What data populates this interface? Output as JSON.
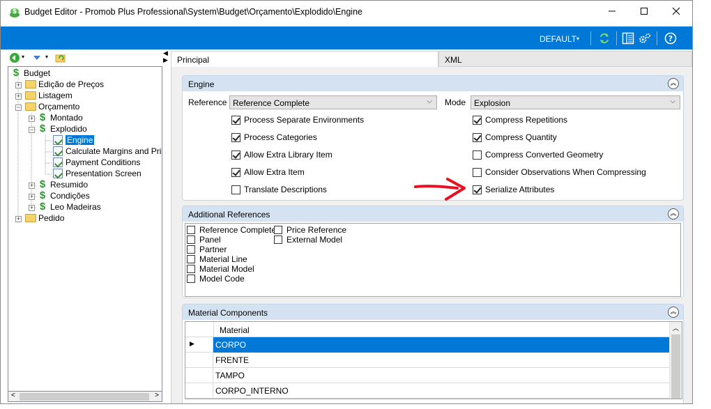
{
  "window": {
    "title": "Budget Editor - Promob Plus Professional\\System\\Budget\\Orçamento\\Explodido\\Engine",
    "minimize": "—",
    "maximize": "☐",
    "close": "✕"
  },
  "toolbar": {
    "default_label": "DEFAULT",
    "caret": "▾",
    "icons": [
      "refresh-icon",
      "panel-icon",
      "settings-icon",
      "help-icon"
    ]
  },
  "tree": {
    "nodes": [
      {
        "label": "Budget"
      },
      {
        "label": "Edição de Preços"
      },
      {
        "label": "Listagem"
      },
      {
        "label": "Orçamento"
      },
      {
        "label": "Montado"
      },
      {
        "label": "Explodido"
      },
      {
        "label": "Engine"
      },
      {
        "label": "Calculate Margins and Price"
      },
      {
        "label": "Payment Conditions"
      },
      {
        "label": "Presentation Screen"
      },
      {
        "label": "Resumido"
      },
      {
        "label": "Condições"
      },
      {
        "label": "Leo Madeiras"
      },
      {
        "label": "Pedido"
      }
    ]
  },
  "tabs": [
    {
      "label": "Principal",
      "active": true
    },
    {
      "label": "XML",
      "active": false
    }
  ],
  "engine": {
    "header": "Engine",
    "reference_label": "Reference",
    "reference_value": "Reference Complete",
    "mode_label": "Mode",
    "mode_value": "Explosion",
    "left_options": [
      {
        "label": "Process Separate Environments",
        "checked": true
      },
      {
        "label": "Process Categories",
        "checked": true
      },
      {
        "label": "Allow Extra Library Item",
        "checked": true
      },
      {
        "label": "Allow Extra Item",
        "checked": true
      },
      {
        "label": "Translate Descriptions",
        "checked": false
      }
    ],
    "right_options": [
      {
        "label": "Compress Repetitions",
        "checked": true
      },
      {
        "label": "Compress Quantity",
        "checked": true
      },
      {
        "label": "Compress Converted Geometry",
        "checked": false
      },
      {
        "label": "Consider Observations When Compressing",
        "checked": false
      },
      {
        "label": "Serialize Attributes",
        "checked": true
      }
    ]
  },
  "additional_references": {
    "header": "Additional References",
    "col1": [
      {
        "label": "Reference Complete",
        "checked": false
      },
      {
        "label": "Panel",
        "checked": false
      },
      {
        "label": "Partner",
        "checked": false
      },
      {
        "label": "Material Line",
        "checked": false
      },
      {
        "label": "Material Model",
        "checked": false
      },
      {
        "label": "Model Code",
        "checked": false
      }
    ],
    "col2": [
      {
        "label": "Price Reference",
        "checked": false
      },
      {
        "label": "External Model",
        "checked": false
      }
    ]
  },
  "material_components": {
    "header": "Material Components",
    "column": "Material",
    "rows": [
      "CORPO",
      "FRENTE",
      "TAMPO",
      "CORPO_INTERNO"
    ],
    "selected_index": 0
  },
  "colors": {
    "accent": "#0078d7",
    "group_header": "#d4e2f1",
    "annotation_arrow": "#e81123"
  }
}
